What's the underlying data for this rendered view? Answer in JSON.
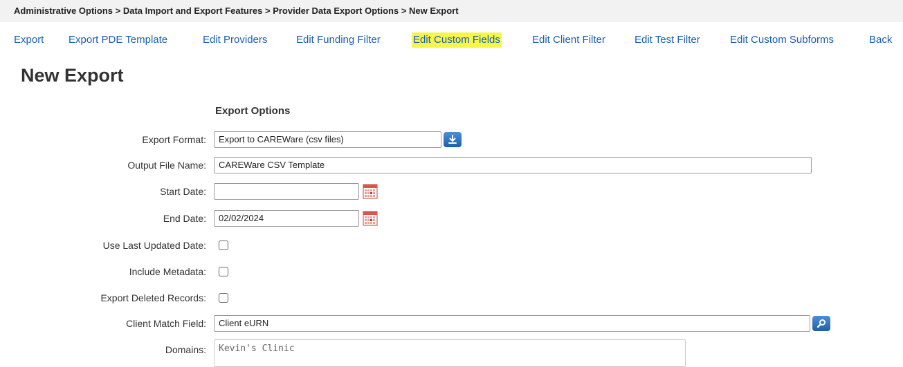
{
  "breadcrumb": "Administrative Options > Data Import and Export Features > Provider Data Export Options > New Export",
  "nav": {
    "items": [
      {
        "label": "Export"
      },
      {
        "label": "Export PDE Template"
      },
      {
        "label": "Edit Providers"
      },
      {
        "label": "Edit Funding Filter"
      },
      {
        "label": "Edit Custom Fields",
        "highlighted": true
      },
      {
        "label": "Edit Client Filter"
      },
      {
        "label": "Edit Test Filter"
      },
      {
        "label": "Edit Custom Subforms"
      },
      {
        "label": "Back"
      }
    ]
  },
  "page_title": "New Export",
  "section_title": "Export Options",
  "form": {
    "export_format": {
      "label": "Export Format:",
      "value": "Export to CAREWare (csv files)"
    },
    "output_file_name": {
      "label": "Output File Name:",
      "value": "CAREWare CSV Template"
    },
    "start_date": {
      "label": "Start Date:",
      "value": ""
    },
    "end_date": {
      "label": "End Date:",
      "value": "02/02/2024"
    },
    "use_last_updated_date": {
      "label": "Use Last Updated Date:",
      "checked": false
    },
    "include_metadata": {
      "label": "Include Metadata:",
      "checked": false
    },
    "export_deleted_records": {
      "label": "Export Deleted Records:",
      "checked": false
    },
    "client_match_field": {
      "label": "Client Match Field:",
      "value": "Client eURN"
    },
    "domains": {
      "label": "Domains:",
      "value": "Kevin's Clinic"
    }
  },
  "icons": {
    "export_format_button": "download-icon",
    "client_match_button": "search-icon",
    "calendar": "calendar-icon"
  },
  "colors": {
    "link": "#1a5fb4",
    "highlight": "#f6f64a",
    "button": "#1f5fa8"
  }
}
